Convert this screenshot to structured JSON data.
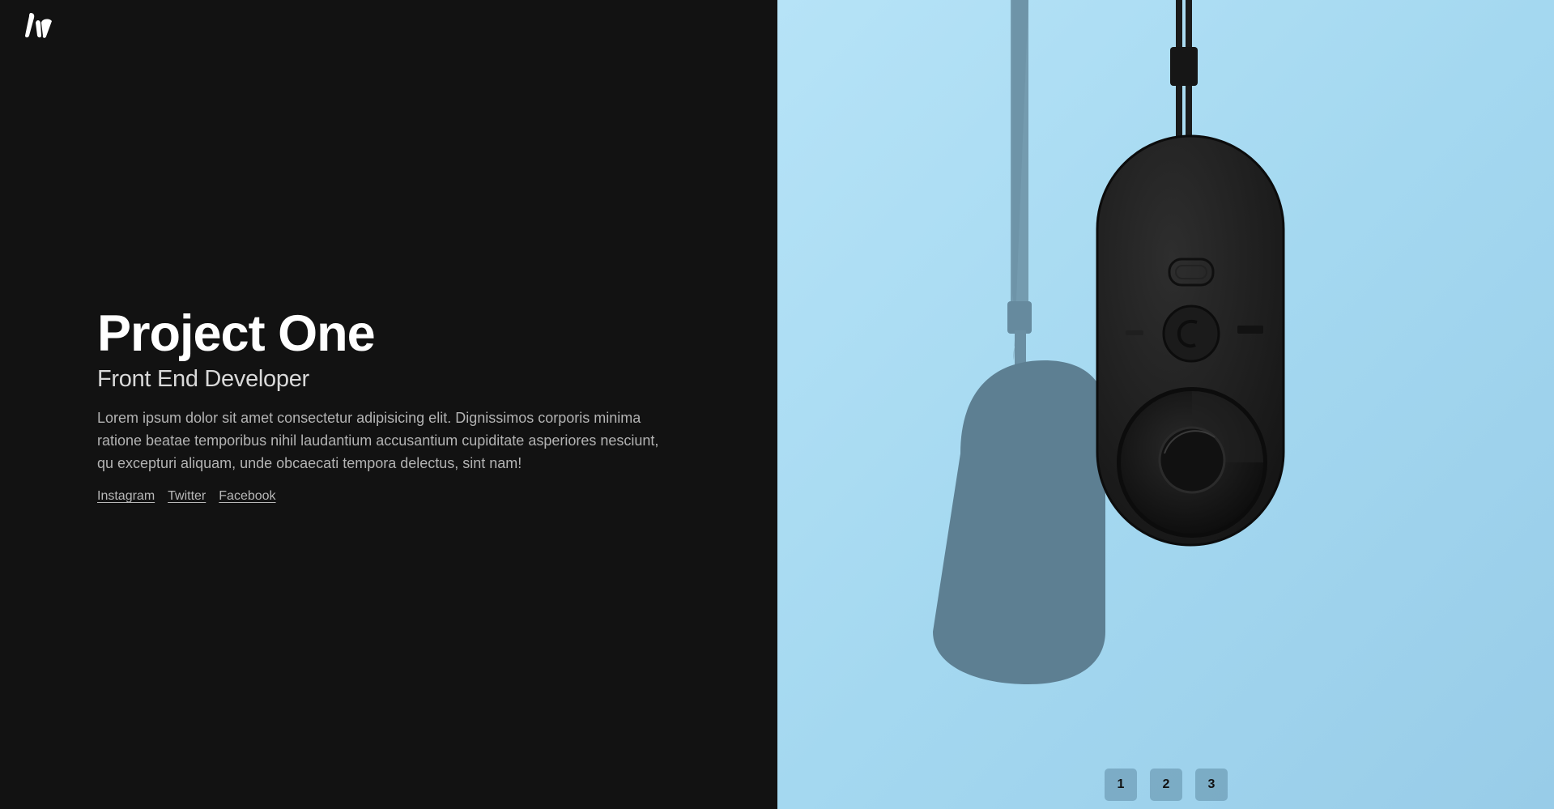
{
  "hero": {
    "title": "Project One",
    "subtitle": "Front End Developer",
    "description": "Lorem ipsum dolor sit amet consectetur adipisicing elit. Dignissimos corporis minima ratione beatae temporibus nihil laudantium accusantium cupiditate asperiores nesciunt, qu excepturi aliquam, unde obcaecati tempora delectus, sint nam!"
  },
  "social": {
    "instagram": "Instagram",
    "twitter": "Twitter",
    "facebook": "Facebook"
  },
  "pager": {
    "page1": "1",
    "page2": "2",
    "page3": "3"
  },
  "logo_icon": "brand-logo-icon",
  "colors": {
    "background": "#121212",
    "title": "#ffffff",
    "text": "#b3b3b3",
    "sky": "#a3d8f0"
  }
}
